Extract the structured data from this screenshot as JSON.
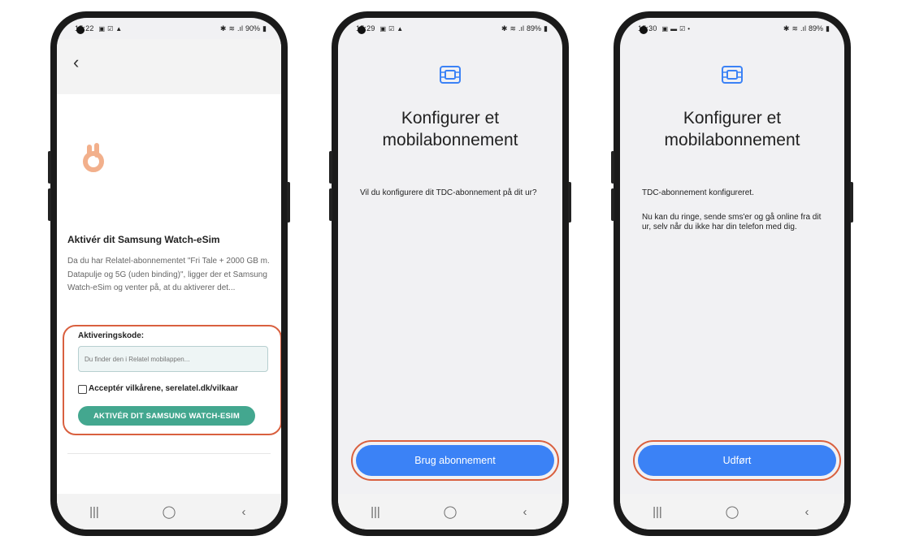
{
  "phone1": {
    "status": {
      "time": "15:22",
      "battery": "90%"
    },
    "title": "Aktivér dit Samsung Watch-eSim",
    "description": "Da du har Relatel-abonnementet \"Fri Tale + 2000 GB m. Datapulje og 5G (uden binding)\", ligger der et Samsung Watch-eSim og venter på, at du aktiverer det...",
    "code_label": "Aktiveringskode:",
    "code_placeholder": "Du finder den i Relatel mobilappen...",
    "terms_label": "Acceptér vilkårene, serelatel.dk/vilkaar",
    "activate_button": "AKTIVÉR DIT SAMSUNG WATCH-ESIM"
  },
  "phone2": {
    "status": {
      "time": "15:29",
      "battery": "89%"
    },
    "title": "Konfigurer et mobilabonnement",
    "text": "Vil du konfigurere dit TDC-abonnement på dit ur?",
    "button": "Brug abonnement"
  },
  "phone3": {
    "status": {
      "time": "15:30",
      "battery": "89%"
    },
    "title": "Konfigurer et mobilabonnement",
    "text1": "TDC-abonnement konfigureret.",
    "text2": "Nu kan du ringe, sende sms'er og gå online fra dit ur, selv når du ikke har din telefon med dig.",
    "button": "Udført"
  },
  "navbar": {
    "recent": "|||",
    "home": "◯",
    "back": "‹"
  },
  "colors": {
    "accent_green": "#43a78f",
    "button_blue": "#3b82f6",
    "highlight_red": "#d9603f",
    "hand_peach": "#f2b08c"
  },
  "icons": [
    "back-arrow-icon",
    "ok-hand-icon",
    "sim-card-icon",
    "recent-apps-icon",
    "home-icon",
    "nav-back-icon"
  ]
}
